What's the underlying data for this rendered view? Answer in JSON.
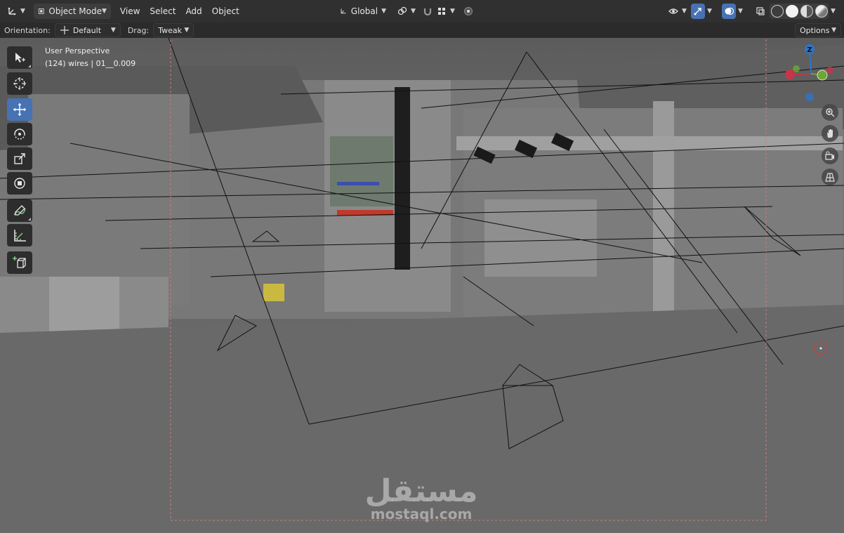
{
  "header": {
    "mode_label": "Object Mode",
    "menus": [
      "View",
      "Select",
      "Add",
      "Object"
    ],
    "transform_orientation": "Global"
  },
  "toolsettings": {
    "orientation_label": "Orientation:",
    "orientation_value": "Default",
    "drag_label": "Drag:",
    "drag_value": "Tweak",
    "options_label": "Options"
  },
  "viewport": {
    "view_name": "User Perspective",
    "object_info": "(124) wires | 01__0.009",
    "gizmo_axis_label": "Z"
  },
  "watermark": {
    "arabic": "مستقل",
    "latin": "mostaql.com"
  },
  "colors": {
    "header_bg": "#303030",
    "accent_blue": "#4772b3",
    "axis_x": "#c8344a",
    "axis_y": "#6ea832",
    "axis_z": "#2f74c8",
    "camera_frame": "#d07a7a"
  }
}
